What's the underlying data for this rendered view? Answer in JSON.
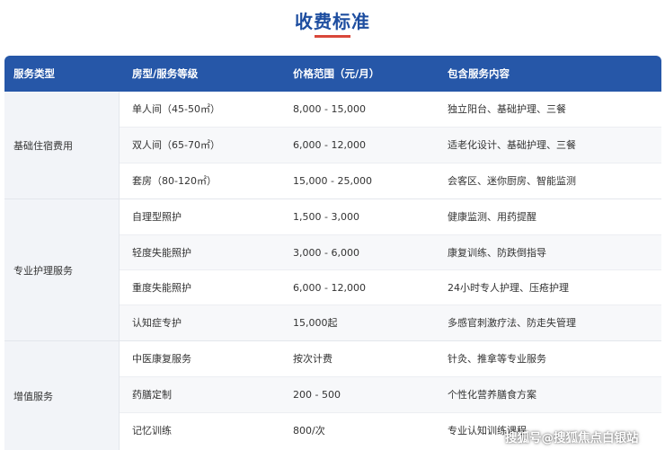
{
  "title": "收费标准",
  "colors": {
    "title": "#1e4ea0",
    "accent": "#d9473a",
    "header_bg": "#2657a8",
    "group_bg": "#f2f4f8"
  },
  "headers": [
    "服务类型",
    "房型/服务等级",
    "价格范围（元/月）",
    "包含服务内容"
  ],
  "groups": [
    {
      "label": "基础住宿费用",
      "rows": [
        {
          "level": "单人间（45-50㎡）",
          "price": "8,000 - 15,000",
          "content": "独立阳台、基础护理、三餐"
        },
        {
          "level": "双人间（65-70㎡）",
          "price": "6,000 - 12,000",
          "content": "适老化设计、基础护理、三餐"
        },
        {
          "level": "套房（80-120㎡）",
          "price": "15,000 - 25,000",
          "content": "会客区、迷你厨房、智能监测"
        }
      ]
    },
    {
      "label": "专业护理服务",
      "rows": [
        {
          "level": "自理型照护",
          "price": "1,500 - 3,000",
          "content": "健康监测、用药提醒"
        },
        {
          "level": "轻度失能照护",
          "price": "3,000 - 6,000",
          "content": "康复训练、防跌倒指导"
        },
        {
          "level": "重度失能照护",
          "price": "6,000 - 12,000",
          "content": "24小时专人护理、压疮护理"
        },
        {
          "level": "认知症专护",
          "price": "15,000起",
          "content": "多感官刺激疗法、防走失管理"
        }
      ]
    },
    {
      "label": "增值服务",
      "rows": [
        {
          "level": "中医康复服务",
          "price": "按次计费",
          "content": "针灸、推拿等专业服务"
        },
        {
          "level": "药膳定制",
          "price": "200 - 500",
          "content": "个性化营养膳食方案"
        },
        {
          "level": "记忆训练",
          "price": "800/次",
          "content": "专业认知训练课程"
        }
      ]
    }
  ],
  "watermark": "搜狐号@搜狐焦点白银站"
}
